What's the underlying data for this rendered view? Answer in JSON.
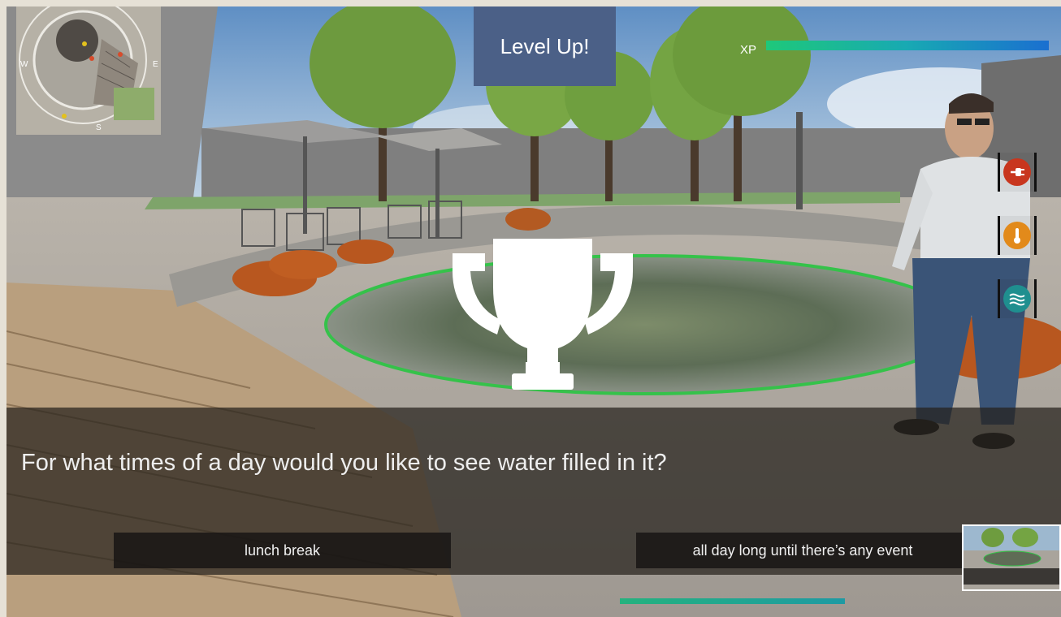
{
  "hud": {
    "level_up_text": "Level Up!",
    "xp_label": "XP",
    "xp_progress": 0.98
  },
  "minimap": {
    "compass_west": "W",
    "compass_east": "E",
    "compass_south": "S"
  },
  "side_icons": [
    {
      "name": "power-plug-icon",
      "color": "#c8361e"
    },
    {
      "name": "thermometer-icon",
      "color": "#e28a1b"
    },
    {
      "name": "water-waves-icon",
      "color": "#1f8f8f"
    }
  ],
  "dialog": {
    "question": "For what times of a day would you like to see water filled in it?",
    "answers": [
      {
        "label": "lunch break"
      },
      {
        "label": "all day long until there’s any event"
      }
    ]
  },
  "colors": {
    "level_up_bg": "#4b6087",
    "xp_start": "#1ec87a",
    "xp_end": "#1a6fd0",
    "pool_ring": "#35c24a"
  }
}
